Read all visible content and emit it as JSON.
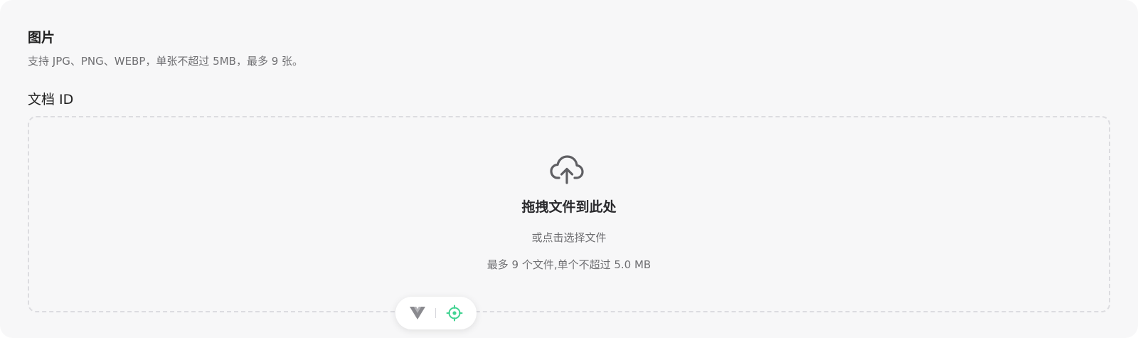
{
  "images_section": {
    "title": "图片",
    "description": "支持 JPG、PNG、WEBP，单张不超过 5MB，最多 9 张。"
  },
  "doc_id_field": {
    "label": "文档 ID"
  },
  "dropzone": {
    "icon": "cloud-upload-icon",
    "title": "拖拽文件到此处",
    "subtitle": "或点击选择文件",
    "limit": "最多 9 个文件,单个不超过 5.0 MB"
  },
  "devtools": {
    "icons": [
      "vue-icon",
      "target-icon"
    ],
    "accent_color": "#42d392"
  },
  "colors": {
    "panel_background": "#f7f7f8",
    "dropzone_border": "#dcdce0",
    "text_primary": "#1f1f1f",
    "text_secondary": "#6f6f72"
  }
}
